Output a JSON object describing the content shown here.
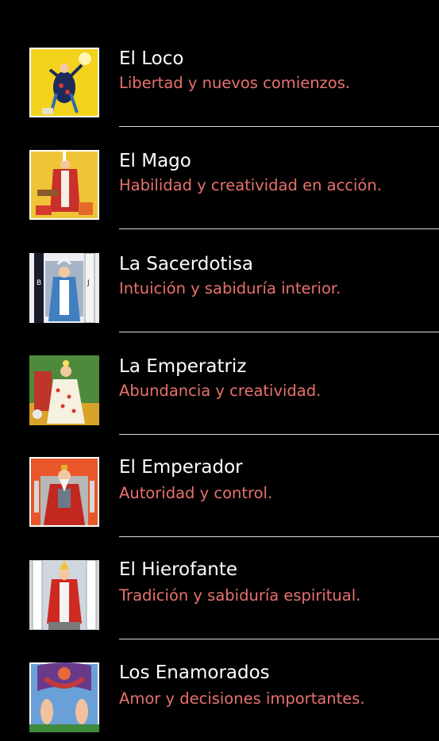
{
  "colors": {
    "background": "#000000",
    "title": "#ffffff",
    "subtitle": "#e8716d",
    "separator": "#dcdcdc"
  },
  "cards": [
    {
      "title": "El Loco",
      "subtitle": "Libertad y nuevos comienzos.",
      "image": "the-fool-card-image"
    },
    {
      "title": "El Mago",
      "subtitle": "Habilidad y creatividad en acción.",
      "image": "the-magician-card-image"
    },
    {
      "title": "La Sacerdotisa",
      "subtitle": "Intuición y sabiduría interior.",
      "image": "the-high-priestess-card-image"
    },
    {
      "title": "La Emperatriz",
      "subtitle": "Abundancia y creatividad.",
      "image": "the-empress-card-image"
    },
    {
      "title": "El Emperador",
      "subtitle": "Autoridad y control.",
      "image": "the-emperor-card-image"
    },
    {
      "title": "El Hierofante",
      "subtitle": "Tradición y sabiduría espiritual.",
      "image": "the-hierophant-card-image"
    },
    {
      "title": "Los Enamorados",
      "subtitle": "Amor y decisiones importantes.",
      "image": "the-lovers-card-image"
    }
  ]
}
